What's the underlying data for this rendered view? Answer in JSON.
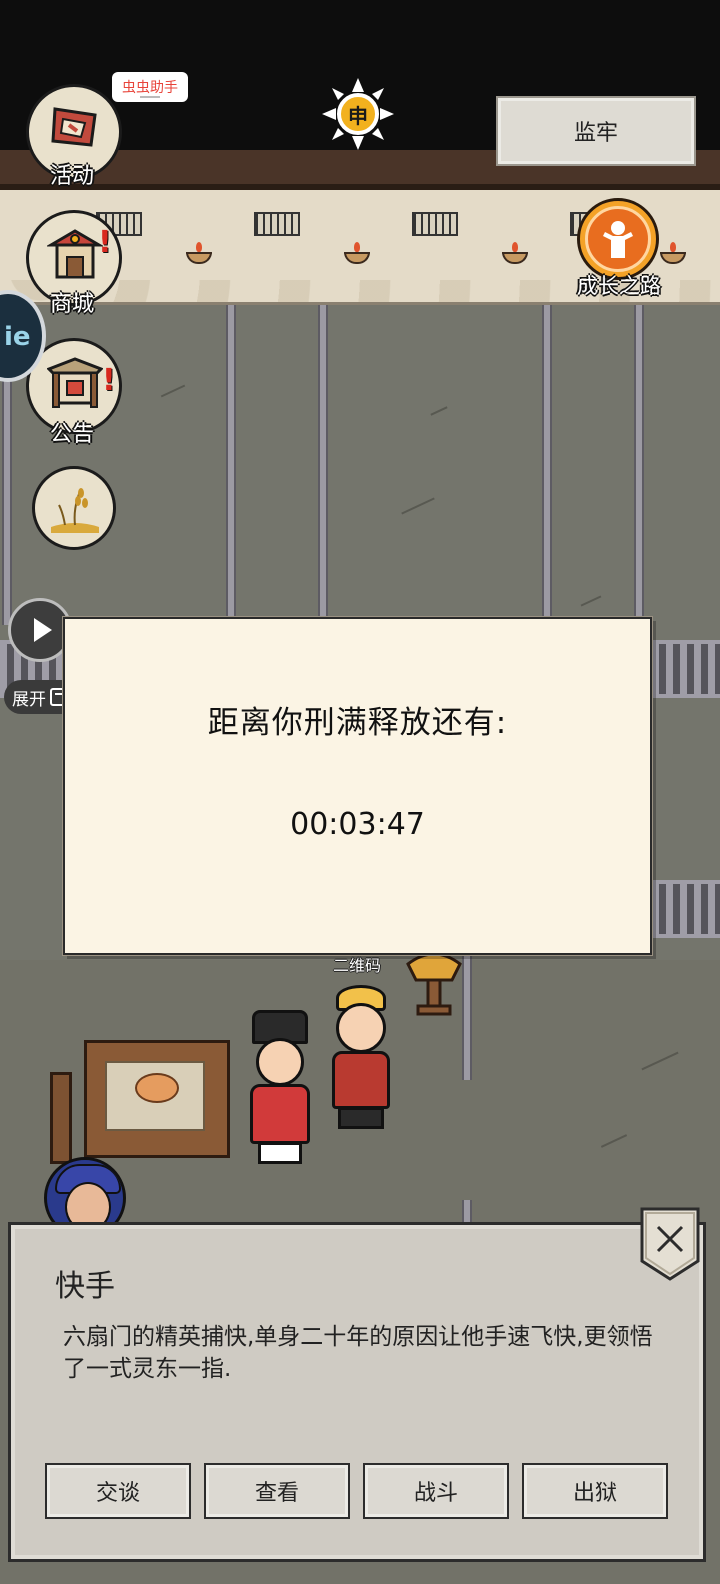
{
  "top": {
    "helper_pill": "虫虫助手",
    "sun_glyph": "申",
    "location": "监牢",
    "growth_label": "成长之路"
  },
  "sidebar": {
    "items": [
      {
        "label": "活动",
        "icon": "flag-icon"
      },
      {
        "label": "商城",
        "icon": "shop-icon",
        "alert": "!"
      },
      {
        "label": "公告",
        "icon": "notice-board-icon",
        "alert": "!"
      },
      {
        "label": "",
        "icon": "wheat-icon"
      }
    ]
  },
  "edge_tab": {
    "text": "ie"
  },
  "float": {
    "expand": "展开"
  },
  "modal": {
    "title": "距离你刑满释放还有:",
    "timer": "00:03:47"
  },
  "scene": {
    "qr_label": "二维码"
  },
  "dialog": {
    "name": "快手",
    "description": "六扇门的精英捕快,单身二十年的原因让他手速飞快,更领悟了一式灵东一指.",
    "buttons": [
      "交谈",
      "查看",
      "战斗",
      "出狱"
    ],
    "close_glyph": "×"
  },
  "colors": {
    "modal_bg": "#fbf4e4",
    "panel_bg": "#cfcbc3",
    "floor": "#74756c",
    "alert": "#d8291f",
    "growth": "#f4a227"
  }
}
